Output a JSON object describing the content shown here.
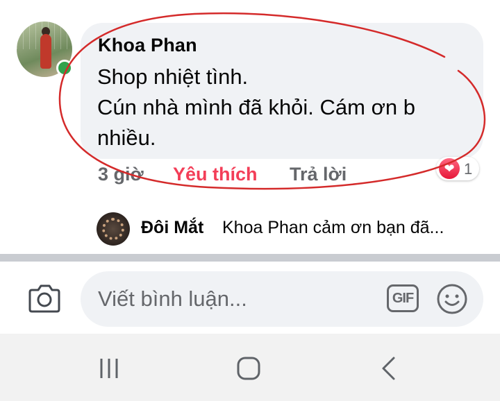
{
  "comment": {
    "author": "Khoa Phan",
    "lines": [
      "Shop nhiệt tình.",
      "Cún nhà mình đã khỏi. Cám ơn b",
      "nhiều."
    ],
    "time": "3 giờ",
    "like_label": "Yêu thích",
    "reply_label": "Trả lời",
    "reaction_count": "1",
    "reaction_icon": "heart-icon",
    "online": true
  },
  "reply_preview": {
    "author": "Đôi Mắt",
    "text": "Khoa Phan cảm ơn bạn đã..."
  },
  "composer": {
    "placeholder": "Viết bình luận...",
    "gif_label": "GIF",
    "camera_icon": "camera-icon",
    "emoji_icon": "smiley-icon"
  },
  "navbar": {
    "items": [
      "recent-apps-icon",
      "home-icon",
      "back-icon"
    ]
  },
  "colors": {
    "bubble": "#f0f2f5",
    "like": "#f33e58",
    "secondary_text": "#65676b",
    "online": "#31a24c",
    "annotation": "#d42a2a"
  }
}
